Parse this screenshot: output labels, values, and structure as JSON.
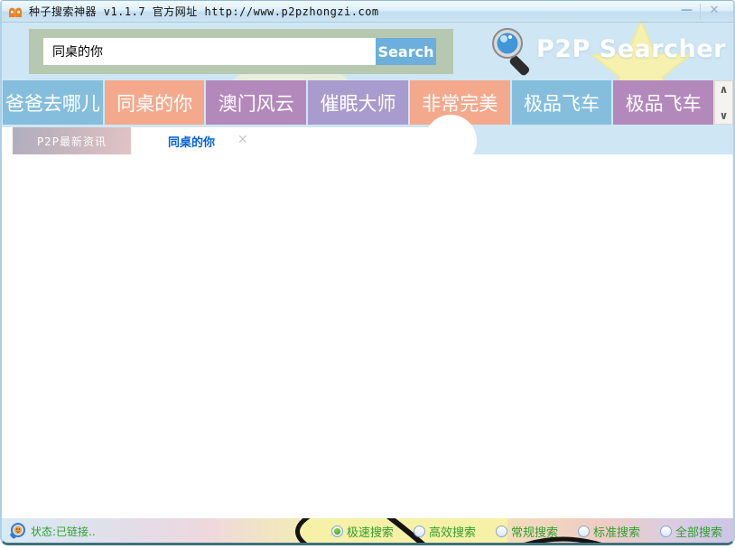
{
  "window": {
    "title": "种子搜索神器 v1.1.7 官方网址 http://www.p2pzhongzi.com",
    "minimize_glyph": "—",
    "close_glyph": "✕"
  },
  "header": {
    "search_value": "同桌的你",
    "search_button_label": "Search",
    "brand_text": "P2P Searcher"
  },
  "hot_buttons": [
    {
      "label": "爸爸去哪儿",
      "color": "#85bedd"
    },
    {
      "label": "同桌的你",
      "color": "#f4a98d"
    },
    {
      "label": "澳门风云",
      "color": "#b389bc"
    },
    {
      "label": "催眠大师",
      "color": "#a89bce"
    },
    {
      "label": "非常完美",
      "color": "#f4a98d"
    },
    {
      "label": "极品飞车",
      "color": "#85bedd"
    },
    {
      "label": "极品飞车",
      "color": "#b389bc"
    }
  ],
  "scrollbar": {
    "up_glyph": "∧",
    "down_glyph": "∨"
  },
  "tabs": {
    "news_tab_label": "P2P最新资讯",
    "active_tab_label": "同桌的你",
    "close_glyph": "✕"
  },
  "status_bar": {
    "status_text": "状态:已链接..",
    "search_modes": [
      {
        "label": "极速搜索",
        "selected": true
      },
      {
        "label": "高效搜索",
        "selected": false
      },
      {
        "label": "常规搜索",
        "selected": false
      },
      {
        "label": "标准搜索",
        "selected": false
      },
      {
        "label": "全部搜索",
        "selected": false
      }
    ]
  },
  "colors": {
    "header_bg": "#cfe6f4",
    "search_panel_bg": "#b6c8b0",
    "search_button_bg": "#6cafdd",
    "status_text_green": "#2f9f2f",
    "active_tab_blue": "#0060d8",
    "titlebar_icon_orange": "#f07f1a",
    "star_yellow": "#f6f1ae"
  }
}
